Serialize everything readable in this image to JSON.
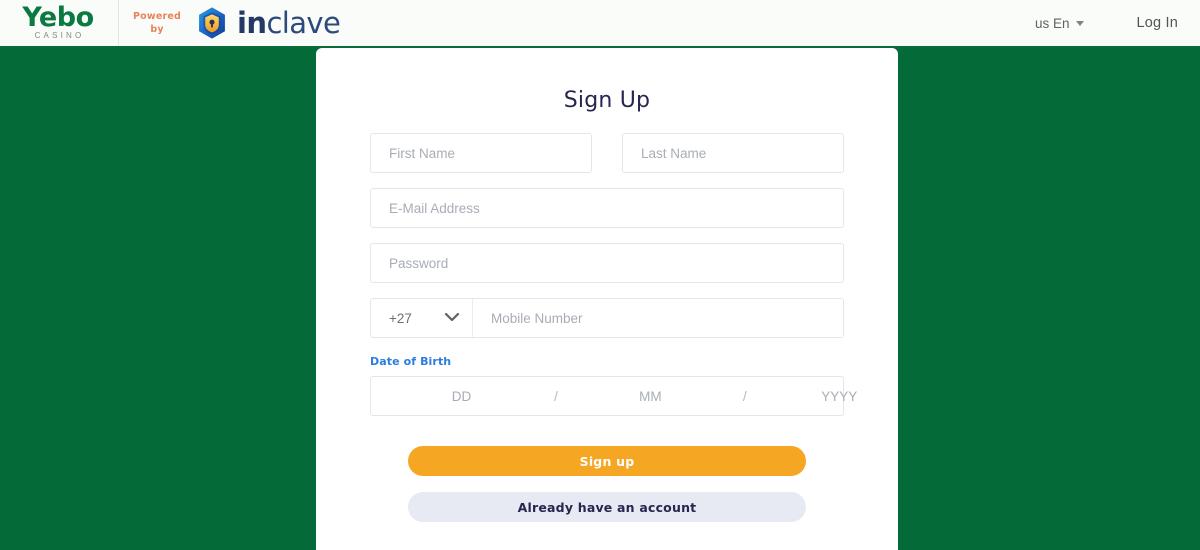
{
  "header": {
    "brand": {
      "name": "Yebo",
      "subtitle": "CASINO"
    },
    "powered": {
      "line1": "Powered",
      "line2": "by"
    },
    "partner": {
      "name_bold": "in",
      "name_light": "clave",
      "icon": "shield-lock-hexagon-icon"
    },
    "language": {
      "label": "us En",
      "caret_icon": "caret-down-icon"
    },
    "login_label": "Log In"
  },
  "card": {
    "title": "Sign Up",
    "fields": {
      "first_name": {
        "placeholder": "First Name",
        "value": ""
      },
      "last_name": {
        "placeholder": "Last Name",
        "value": ""
      },
      "email": {
        "placeholder": "E-Mail Address",
        "value": ""
      },
      "password": {
        "placeholder": "Password",
        "value": ""
      },
      "country_code": {
        "selected": "+27",
        "chevron_icon": "chevron-down-icon"
      },
      "mobile": {
        "placeholder": "Mobile Number",
        "value": ""
      },
      "dob": {
        "label": "Date of Birth",
        "day": {
          "placeholder": "DD",
          "value": ""
        },
        "sep1": "/",
        "month": {
          "placeholder": "MM",
          "value": ""
        },
        "sep2": "/",
        "year": {
          "placeholder": "YYYY",
          "value": ""
        }
      }
    },
    "buttons": {
      "submit": "Sign up",
      "existing_account": "Already have an account"
    }
  },
  "colors": {
    "background_green": "#046A38",
    "accent_orange": "#F5A623",
    "brand_green": "#0a7a42",
    "label_blue": "#2a7de1",
    "secondary_button": "#e7eaf2",
    "navy_text": "#26264f"
  }
}
